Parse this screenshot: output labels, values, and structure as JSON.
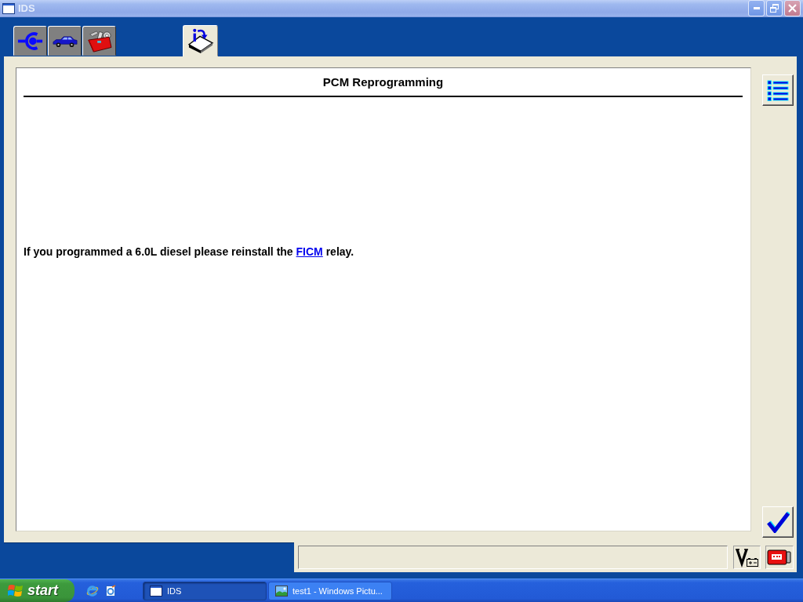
{
  "window": {
    "title": "IDS"
  },
  "tabs": [
    {
      "kind": "connector",
      "selected": false
    },
    {
      "kind": "vehicle",
      "selected": false
    },
    {
      "kind": "toolbox",
      "selected": false
    },
    {
      "kind": "info",
      "selected": true
    }
  ],
  "page": {
    "title": "PCM Reprogramming",
    "message": [
      {
        "kind": "text",
        "text": "If you programmed a 6.0L diesel please reinstall the "
      },
      {
        "kind": "link",
        "text": "FICM"
      },
      {
        "kind": "text",
        "text": " relay."
      }
    ]
  },
  "taskbar": {
    "start": "start",
    "tasks": [
      {
        "kind": "window",
        "label": "IDS",
        "selected": true
      },
      {
        "kind": "picture",
        "label": "test1 - Windows Pictu...",
        "selected": false
      }
    ]
  }
}
